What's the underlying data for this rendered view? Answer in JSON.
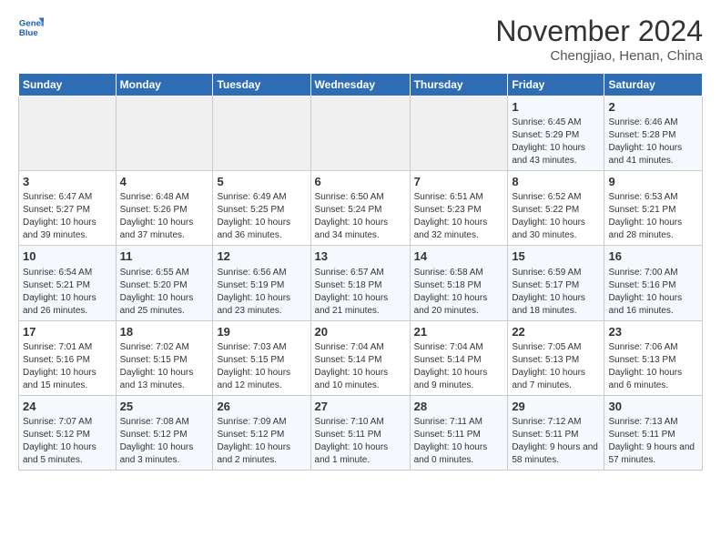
{
  "header": {
    "logo_general": "General",
    "logo_blue": "Blue",
    "month_title": "November 2024",
    "location": "Chengjiao, Henan, China"
  },
  "days_of_week": [
    "Sunday",
    "Monday",
    "Tuesday",
    "Wednesday",
    "Thursday",
    "Friday",
    "Saturday"
  ],
  "weeks": [
    [
      {
        "day": "",
        "empty": true
      },
      {
        "day": "",
        "empty": true
      },
      {
        "day": "",
        "empty": true
      },
      {
        "day": "",
        "empty": true
      },
      {
        "day": "",
        "empty": true
      },
      {
        "day": "1",
        "sunrise": "Sunrise: 6:45 AM",
        "sunset": "Sunset: 5:29 PM",
        "daylight": "Daylight: 10 hours and 43 minutes."
      },
      {
        "day": "2",
        "sunrise": "Sunrise: 6:46 AM",
        "sunset": "Sunset: 5:28 PM",
        "daylight": "Daylight: 10 hours and 41 minutes."
      }
    ],
    [
      {
        "day": "3",
        "sunrise": "Sunrise: 6:47 AM",
        "sunset": "Sunset: 5:27 PM",
        "daylight": "Daylight: 10 hours and 39 minutes."
      },
      {
        "day": "4",
        "sunrise": "Sunrise: 6:48 AM",
        "sunset": "Sunset: 5:26 PM",
        "daylight": "Daylight: 10 hours and 37 minutes."
      },
      {
        "day": "5",
        "sunrise": "Sunrise: 6:49 AM",
        "sunset": "Sunset: 5:25 PM",
        "daylight": "Daylight: 10 hours and 36 minutes."
      },
      {
        "day": "6",
        "sunrise": "Sunrise: 6:50 AM",
        "sunset": "Sunset: 5:24 PM",
        "daylight": "Daylight: 10 hours and 34 minutes."
      },
      {
        "day": "7",
        "sunrise": "Sunrise: 6:51 AM",
        "sunset": "Sunset: 5:23 PM",
        "daylight": "Daylight: 10 hours and 32 minutes."
      },
      {
        "day": "8",
        "sunrise": "Sunrise: 6:52 AM",
        "sunset": "Sunset: 5:22 PM",
        "daylight": "Daylight: 10 hours and 30 minutes."
      },
      {
        "day": "9",
        "sunrise": "Sunrise: 6:53 AM",
        "sunset": "Sunset: 5:21 PM",
        "daylight": "Daylight: 10 hours and 28 minutes."
      }
    ],
    [
      {
        "day": "10",
        "sunrise": "Sunrise: 6:54 AM",
        "sunset": "Sunset: 5:21 PM",
        "daylight": "Daylight: 10 hours and 26 minutes."
      },
      {
        "day": "11",
        "sunrise": "Sunrise: 6:55 AM",
        "sunset": "Sunset: 5:20 PM",
        "daylight": "Daylight: 10 hours and 25 minutes."
      },
      {
        "day": "12",
        "sunrise": "Sunrise: 6:56 AM",
        "sunset": "Sunset: 5:19 PM",
        "daylight": "Daylight: 10 hours and 23 minutes."
      },
      {
        "day": "13",
        "sunrise": "Sunrise: 6:57 AM",
        "sunset": "Sunset: 5:18 PM",
        "daylight": "Daylight: 10 hours and 21 minutes."
      },
      {
        "day": "14",
        "sunrise": "Sunrise: 6:58 AM",
        "sunset": "Sunset: 5:18 PM",
        "daylight": "Daylight: 10 hours and 20 minutes."
      },
      {
        "day": "15",
        "sunrise": "Sunrise: 6:59 AM",
        "sunset": "Sunset: 5:17 PM",
        "daylight": "Daylight: 10 hours and 18 minutes."
      },
      {
        "day": "16",
        "sunrise": "Sunrise: 7:00 AM",
        "sunset": "Sunset: 5:16 PM",
        "daylight": "Daylight: 10 hours and 16 minutes."
      }
    ],
    [
      {
        "day": "17",
        "sunrise": "Sunrise: 7:01 AM",
        "sunset": "Sunset: 5:16 PM",
        "daylight": "Daylight: 10 hours and 15 minutes."
      },
      {
        "day": "18",
        "sunrise": "Sunrise: 7:02 AM",
        "sunset": "Sunset: 5:15 PM",
        "daylight": "Daylight: 10 hours and 13 minutes."
      },
      {
        "day": "19",
        "sunrise": "Sunrise: 7:03 AM",
        "sunset": "Sunset: 5:15 PM",
        "daylight": "Daylight: 10 hours and 12 minutes."
      },
      {
        "day": "20",
        "sunrise": "Sunrise: 7:04 AM",
        "sunset": "Sunset: 5:14 PM",
        "daylight": "Daylight: 10 hours and 10 minutes."
      },
      {
        "day": "21",
        "sunrise": "Sunrise: 7:04 AM",
        "sunset": "Sunset: 5:14 PM",
        "daylight": "Daylight: 10 hours and 9 minutes."
      },
      {
        "day": "22",
        "sunrise": "Sunrise: 7:05 AM",
        "sunset": "Sunset: 5:13 PM",
        "daylight": "Daylight: 10 hours and 7 minutes."
      },
      {
        "day": "23",
        "sunrise": "Sunrise: 7:06 AM",
        "sunset": "Sunset: 5:13 PM",
        "daylight": "Daylight: 10 hours and 6 minutes."
      }
    ],
    [
      {
        "day": "24",
        "sunrise": "Sunrise: 7:07 AM",
        "sunset": "Sunset: 5:12 PM",
        "daylight": "Daylight: 10 hours and 5 minutes."
      },
      {
        "day": "25",
        "sunrise": "Sunrise: 7:08 AM",
        "sunset": "Sunset: 5:12 PM",
        "daylight": "Daylight: 10 hours and 3 minutes."
      },
      {
        "day": "26",
        "sunrise": "Sunrise: 7:09 AM",
        "sunset": "Sunset: 5:12 PM",
        "daylight": "Daylight: 10 hours and 2 minutes."
      },
      {
        "day": "27",
        "sunrise": "Sunrise: 7:10 AM",
        "sunset": "Sunset: 5:11 PM",
        "daylight": "Daylight: 10 hours and 1 minute."
      },
      {
        "day": "28",
        "sunrise": "Sunrise: 7:11 AM",
        "sunset": "Sunset: 5:11 PM",
        "daylight": "Daylight: 10 hours and 0 minutes."
      },
      {
        "day": "29",
        "sunrise": "Sunrise: 7:12 AM",
        "sunset": "Sunset: 5:11 PM",
        "daylight": "Daylight: 9 hours and 58 minutes."
      },
      {
        "day": "30",
        "sunrise": "Sunrise: 7:13 AM",
        "sunset": "Sunset: 5:11 PM",
        "daylight": "Daylight: 9 hours and 57 minutes."
      }
    ]
  ]
}
